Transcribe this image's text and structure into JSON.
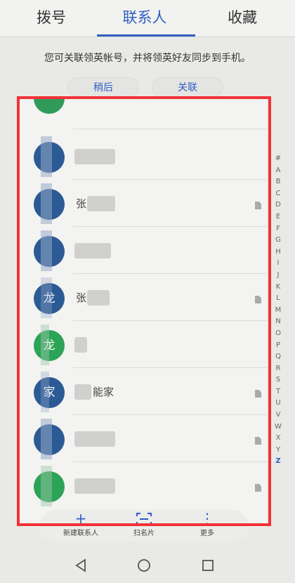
{
  "tabs": [
    {
      "label": "拨号"
    },
    {
      "label": "联系人"
    },
    {
      "label": "收藏"
    }
  ],
  "notice": "您可关联领英帐号，并将领英好友同步到手机。",
  "buttons": {
    "later": "稍后",
    "link": "关联"
  },
  "contacts": [
    {
      "avatar_char": "",
      "name_visible": "",
      "color": "#2f9a5a",
      "has_card": false
    },
    {
      "avatar_char": "",
      "name_visible": "",
      "color": "#2c5a94",
      "has_card": false
    },
    {
      "avatar_char": "",
      "name_visible": "张",
      "color": "#2c5a94",
      "has_card": true
    },
    {
      "avatar_char": "",
      "name_visible": "",
      "color": "#2c5a94",
      "has_card": false
    },
    {
      "avatar_char": "龙",
      "name_visible": "张",
      "color": "#2c5a94",
      "has_card": true
    },
    {
      "avatar_char": "龙",
      "name_visible": "",
      "color": "#2ca356",
      "has_card": false
    },
    {
      "avatar_char": "家",
      "name_visible": "能家",
      "color": "#2c5a94",
      "has_card": true
    },
    {
      "avatar_char": "",
      "name_visible": "",
      "color": "#2c5a94",
      "has_card": true
    },
    {
      "avatar_char": "",
      "name_visible": "",
      "color": "#2ca356",
      "has_card": true
    }
  ],
  "alphabet": [
    "#",
    "A",
    "B",
    "C",
    "D",
    "E",
    "F",
    "G",
    "H",
    "I",
    "J",
    "K",
    "L",
    "M",
    "N",
    "O",
    "P",
    "Q",
    "R",
    "S",
    "T",
    "U",
    "V",
    "W",
    "X",
    "Y",
    "Z"
  ],
  "active_letter": "Z",
  "bottom_bar": {
    "new_contact": {
      "icon": "+",
      "label": "新建联系人"
    },
    "scan_card": {
      "icon": "⌗",
      "label": "扫名片"
    },
    "more": {
      "icon": "⋮",
      "label": "更多"
    }
  },
  "colors": {
    "accent": "#2f5fc2",
    "highlight": "#f13238"
  }
}
